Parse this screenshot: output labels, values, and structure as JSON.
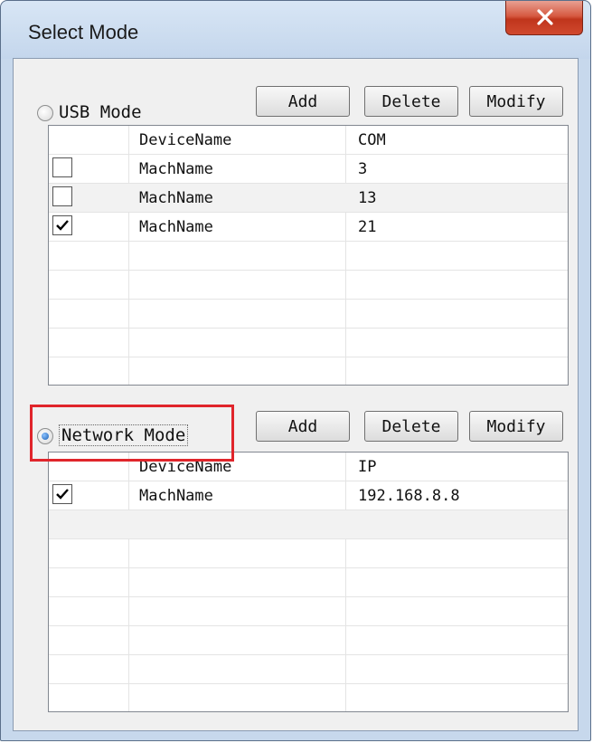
{
  "window": {
    "title": "Select Mode"
  },
  "usb": {
    "mode_label": "USB Mode",
    "selected": false,
    "add_label": "Add",
    "delete_label": "Delete",
    "modify_label": "Modify",
    "columns": [
      "DeviceName",
      "COM"
    ],
    "rows": [
      {
        "checked": false,
        "name": "MachName",
        "value": "3"
      },
      {
        "checked": false,
        "name": "MachName",
        "value": "13"
      },
      {
        "checked": true,
        "name": "MachName",
        "value": "21"
      }
    ]
  },
  "network": {
    "mode_label": "Network Mode",
    "selected": true,
    "add_label": "Add",
    "delete_label": "Delete",
    "modify_label": "Modify",
    "columns": [
      "DeviceName",
      "IP"
    ],
    "rows": [
      {
        "checked": true,
        "name": "MachName",
        "value": "192.168.8.8"
      }
    ]
  },
  "colors": {
    "highlight": "#e0252b",
    "close_button": "#c7452c"
  },
  "icons": {
    "close": "close-icon",
    "check": "check-icon"
  }
}
